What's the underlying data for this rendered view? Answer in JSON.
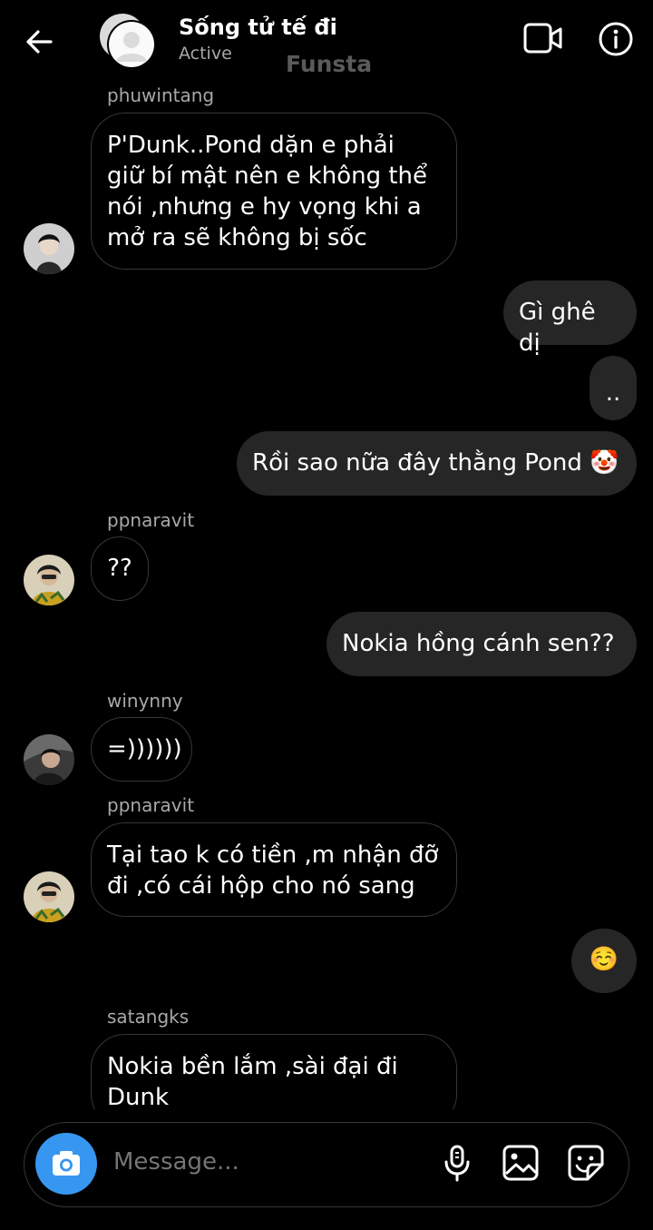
{
  "header": {
    "title": "Sống tử tế đi",
    "status": "Active",
    "watermark": "Funsta"
  },
  "messages": [
    {
      "sender": "phuwintang",
      "text": [
        "P'Dunk..Pond dặn e phải",
        "giữ bí mật nên e không thể",
        "nói ,nhưng e hy vọng khi a",
        "mở ra sẽ không bị sốc"
      ]
    },
    {
      "text": "Gì ghê dị"
    },
    {
      "text": ".."
    },
    {
      "text": "Rồi sao nữa đây thằng Pond 🤡"
    },
    {
      "sender": "ppnaravit",
      "text": "??"
    },
    {
      "text": "Nokia hồng cánh sen??"
    },
    {
      "sender": "winynny",
      "text": "=))))))"
    },
    {
      "sender": "ppnaravit",
      "text": [
        "Tại tao k có tiền ,m nhận đỡ",
        "đi ,có cái hộp cho nó sang"
      ]
    },
    {
      "text": "☺️"
    },
    {
      "sender": "satangks",
      "text": [
        "Nokia bền lắm ,sài đại đi",
        "Dunk"
      ]
    }
  ],
  "composer": {
    "placeholder": "Message..."
  },
  "colors": {
    "background": "#000000",
    "incoming_border": "#363636",
    "outgoing_bubble": "#262626",
    "camera_button": "#3797f0",
    "secondary_text": "#a8a8a8"
  },
  "icons": [
    "back-arrow-icon",
    "video-call-icon",
    "info-icon",
    "camera-icon",
    "microphone-icon",
    "gallery-icon",
    "sticker-icon"
  ]
}
